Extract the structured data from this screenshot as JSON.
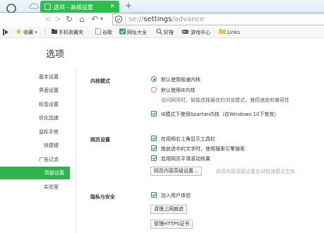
{
  "titlebar": {
    "tab_title": "选项 - 高级设置",
    "tab_close": "×",
    "new_tab": "+"
  },
  "nav": {
    "back": "<",
    "forward": ">",
    "refresh": "↻",
    "home": "⌂",
    "undo": "↶",
    "undo_dropdown": "▾",
    "url_scheme": "se://",
    "url_bold": "settings",
    "url_rest": "/advance"
  },
  "bookmarks": {
    "collect": "收藏",
    "items": [
      "手机收藏夹",
      "谷歌",
      "网址大全",
      "好搜",
      "游戏中心",
      "Links"
    ]
  },
  "page": {
    "title": "选项",
    "sidebar": [
      "基本设置",
      "界面设置",
      "标签设置",
      "优化加速",
      "鼠标手势",
      "快捷键",
      "广告过滤",
      "高级设置",
      "实验室"
    ],
    "active_index": 7
  },
  "kernel": {
    "label": "内核模式",
    "option1": "默认使用极速内核",
    "option2": "默认使用IE内核",
    "desc": "访问网页时，智能选择最佳的浏览模式，兼顾速度和兼容性",
    "spartan": "IE模式下使用Spartan内核（仅Windows 10下有效）"
  },
  "webpage": {
    "label": "网页设置",
    "opt1": "在视频右上角显示工具栏",
    "opt2": "拖放选中的文字时，使用搜索引擎搜索",
    "opt3": "启用网页平滑滚动效果",
    "button": "网页内容高级设置...",
    "note": "网页内容高级设置仅对极速模式生效"
  },
  "privacy": {
    "label": "隐私与安全",
    "opt1": "加入用户体验",
    "button1": "清理上网痕迹",
    "button2": "管理HTTPS证书"
  }
}
